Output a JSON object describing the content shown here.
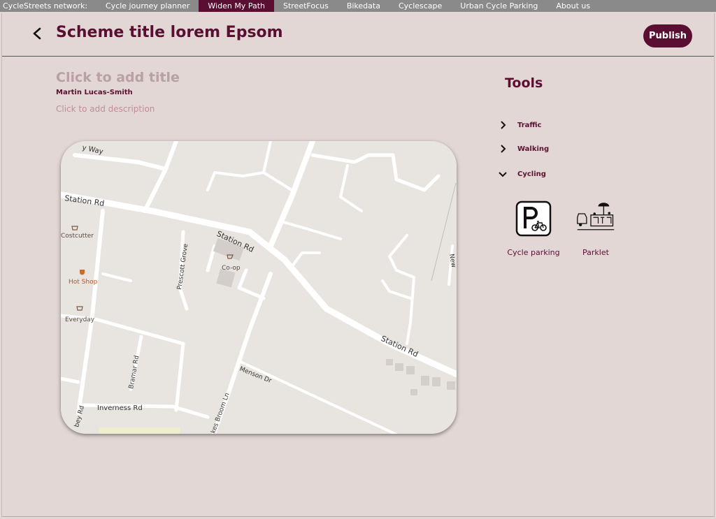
{
  "topnav": {
    "network_label": "CycleStreets network:",
    "items": [
      {
        "label": "Cycle journey planner"
      },
      {
        "label": "Widen My Path"
      },
      {
        "label": "StreetFocus"
      },
      {
        "label": "Bikedata"
      },
      {
        "label": "Cyclescape"
      },
      {
        "label": "Urban Cycle Parking"
      },
      {
        "label": "About us"
      }
    ],
    "active_item": "Widen My Path"
  },
  "header": {
    "back_icon": "chevron-left-icon",
    "title": "Scheme title lorem Epsom",
    "publish_label": "Publish"
  },
  "scheme": {
    "title_placeholder": "Click to add title",
    "author": "Martin Lucas-Smith",
    "description_placeholder": "Click to add description"
  },
  "map": {
    "street_labels": [
      "Station Rd",
      "Station Rd",
      "Station Rd",
      "Prescott Grove",
      "Bramar Rd",
      "Inverness Rd",
      "Menson Dr",
      "kes Broom Ln",
      "bey Rd",
      "y Way",
      "New"
    ],
    "poi_labels": [
      "Costcutter",
      "Hot Shop",
      "Everyday",
      "Co-op"
    ]
  },
  "tools": {
    "title": "Tools",
    "categories": [
      {
        "label": "Traffic",
        "expanded": false
      },
      {
        "label": "Walking",
        "expanded": false
      },
      {
        "label": "Cycling",
        "expanded": true
      }
    ],
    "cycling_tools": [
      {
        "label": "Cycle parking",
        "icon": "cycle-parking-icon"
      },
      {
        "label": "Parklet",
        "icon": "parklet-icon"
      }
    ]
  },
  "colors": {
    "brand": "#5a0f32",
    "background": "#e2d7d4",
    "placeholder_title": "#b9a0a6",
    "placeholder_desc": "#c48c95",
    "nav_bar": "#8a8a8a"
  }
}
